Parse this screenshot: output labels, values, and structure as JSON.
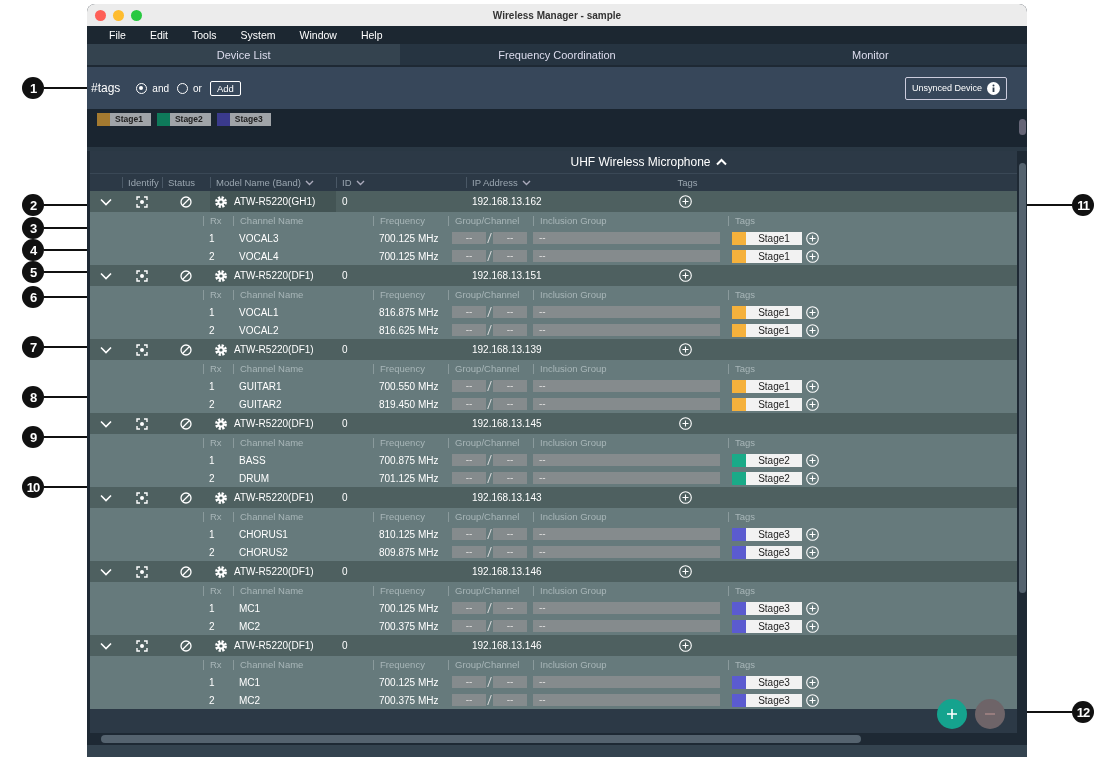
{
  "window": {
    "title": "Wireless Manager - sample"
  },
  "menu": [
    "File",
    "Edit",
    "Tools",
    "System",
    "Window",
    "Help"
  ],
  "tabs": [
    {
      "label": "Device List",
      "selected": true
    },
    {
      "label": "Frequency Coordination",
      "selected": false
    },
    {
      "label": "Monitor",
      "selected": false
    }
  ],
  "tag_filter": {
    "label": "#tags",
    "modes": [
      {
        "label": "and",
        "selected": true
      },
      {
        "label": "or",
        "selected": false
      }
    ],
    "add_button": "Add",
    "unsynced_button": "Unsynced Device"
  },
  "tags": [
    {
      "label": "Stage1",
      "color": "#a47a30"
    },
    {
      "label": "Stage2",
      "color": "#0e7a5a"
    },
    {
      "label": "Stage3",
      "color": "#3a3a8c"
    }
  ],
  "device_list": {
    "title": "UHF Wireless Microphone",
    "columns": [
      "Identify",
      "Status",
      "Model Name (Band)",
      "ID",
      "IP Address",
      "Tags"
    ],
    "devices": [
      {
        "model": "ATW-R5220(GH1)",
        "id": "0",
        "ip": "192.168.13.162",
        "selected": true,
        "channel_columns": [
          "Rx",
          "Channel Name",
          "Frequency",
          "Group/Channel",
          "Inclusion Group",
          "Tags"
        ],
        "channels": [
          {
            "rx": "1",
            "name": "VOCAL3",
            "frequency": "700.125 MHz",
            "group": "--",
            "channel": "--",
            "inclusion_group": "--",
            "tag": {
              "label": "Stage1",
              "color": "#f5b13c"
            }
          },
          {
            "rx": "2",
            "name": "VOCAL4",
            "frequency": "700.125 MHz",
            "group": "--",
            "channel": "--",
            "inclusion_group": "--",
            "tag": {
              "label": "Stage1",
              "color": "#f5b13c"
            }
          }
        ]
      },
      {
        "model": "ATW-R5220(DF1)",
        "id": "0",
        "ip": "192.168.13.151",
        "selected": false,
        "channel_columns": [
          "Rx",
          "Channel Name",
          "Frequency",
          "Group/Channel",
          "Inclusion Group",
          "Tags"
        ],
        "channels": [
          {
            "rx": "1",
            "name": "VOCAL1",
            "frequency": "816.875 MHz",
            "group": "--",
            "channel": "--",
            "inclusion_group": "--",
            "tag": {
              "label": "Stage1",
              "color": "#f5b13c"
            }
          },
          {
            "rx": "2",
            "name": "VOCAL2",
            "frequency": "816.625 MHz",
            "group": "--",
            "channel": "--",
            "inclusion_group": "--",
            "tag": {
              "label": "Stage1",
              "color": "#f5b13c"
            }
          }
        ]
      },
      {
        "model": "ATW-R5220(DF1)",
        "id": "0",
        "ip": "192.168.13.139",
        "selected": false,
        "channel_columns": [
          "Rx",
          "Channel Name",
          "Frequency",
          "Group/Channel",
          "Inclusion Group",
          "Tags"
        ],
        "channels": [
          {
            "rx": "1",
            "name": "GUITAR1",
            "frequency": "700.550 MHz",
            "group": "--",
            "channel": "--",
            "inclusion_group": "--",
            "tag": {
              "label": "Stage1",
              "color": "#f5b13c"
            }
          },
          {
            "rx": "2",
            "name": "GUITAR2",
            "frequency": "819.450 MHz",
            "group": "--",
            "channel": "--",
            "inclusion_group": "--",
            "tag": {
              "label": "Stage1",
              "color": "#f5b13c"
            }
          }
        ]
      },
      {
        "model": "ATW-R5220(DF1)",
        "id": "0",
        "ip": "192.168.13.145",
        "selected": false,
        "channel_columns": [
          "Rx",
          "Channel Name",
          "Frequency",
          "Group/Channel",
          "Inclusion Group",
          "Tags"
        ],
        "channels": [
          {
            "rx": "1",
            "name": "BASS",
            "frequency": "700.875 MHz",
            "group": "--",
            "channel": "--",
            "inclusion_group": "--",
            "tag": {
              "label": "Stage2",
              "color": "#1aaa88"
            }
          },
          {
            "rx": "2",
            "name": "DRUM",
            "frequency": "701.125 MHz",
            "group": "--",
            "channel": "--",
            "inclusion_group": "--",
            "tag": {
              "label": "Stage2",
              "color": "#1aaa88"
            }
          }
        ]
      },
      {
        "model": "ATW-R5220(DF1)",
        "id": "0",
        "ip": "192.168.13.143",
        "selected": false,
        "channel_columns": [
          "Rx",
          "Channel Name",
          "Frequency",
          "Group/Channel",
          "Inclusion Group",
          "Tags"
        ],
        "channels": [
          {
            "rx": "1",
            "name": "CHORUS1",
            "frequency": "810.125 MHz",
            "group": "--",
            "channel": "--",
            "inclusion_group": "--",
            "tag": {
              "label": "Stage3",
              "color": "#5b5bd0"
            }
          },
          {
            "rx": "2",
            "name": "CHORUS2",
            "frequency": "809.875 MHz",
            "group": "--",
            "channel": "--",
            "inclusion_group": "--",
            "tag": {
              "label": "Stage3",
              "color": "#5b5bd0"
            }
          }
        ]
      },
      {
        "model": "ATW-R5220(DF1)",
        "id": "0",
        "ip": "192.168.13.146",
        "selected": false,
        "channel_columns": [
          "Rx",
          "Channel Name",
          "Frequency",
          "Group/Channel",
          "Inclusion Group",
          "Tags"
        ],
        "channels": [
          {
            "rx": "1",
            "name": "MC1",
            "frequency": "700.125 MHz",
            "group": "--",
            "channel": "--",
            "inclusion_group": "--",
            "tag": {
              "label": "Stage3",
              "color": "#5b5bd0"
            }
          },
          {
            "rx": "2",
            "name": "MC2",
            "frequency": "700.375 MHz",
            "group": "--",
            "channel": "--",
            "inclusion_group": "--",
            "tag": {
              "label": "Stage3",
              "color": "#5b5bd0"
            }
          }
        ]
      },
      {
        "model": "ATW-R5220(DF1)",
        "id": "0",
        "ip": "192.168.13.146",
        "selected": false,
        "channel_columns": [
          "Rx",
          "Channel Name",
          "Frequency",
          "Group/Channel",
          "Inclusion Group",
          "Tags"
        ],
        "channels": [
          {
            "rx": "1",
            "name": "MC1",
            "frequency": "700.125 MHz",
            "group": "--",
            "channel": "--",
            "inclusion_group": "--",
            "tag": {
              "label": "Stage3",
              "color": "#5b5bd0"
            }
          },
          {
            "rx": "2",
            "name": "MC2",
            "frequency": "700.375 MHz",
            "group": "--",
            "channel": "--",
            "inclusion_group": "--",
            "tag": {
              "label": "Stage3",
              "color": "#5b5bd0"
            }
          }
        ]
      }
    ]
  },
  "floating_buttons": {
    "remove_disabled": true
  },
  "left_callouts": [
    "1",
    "2",
    "3",
    "4",
    "5",
    "6",
    "7",
    "8",
    "9",
    "10"
  ],
  "right_callouts": [
    "11",
    "12"
  ]
}
